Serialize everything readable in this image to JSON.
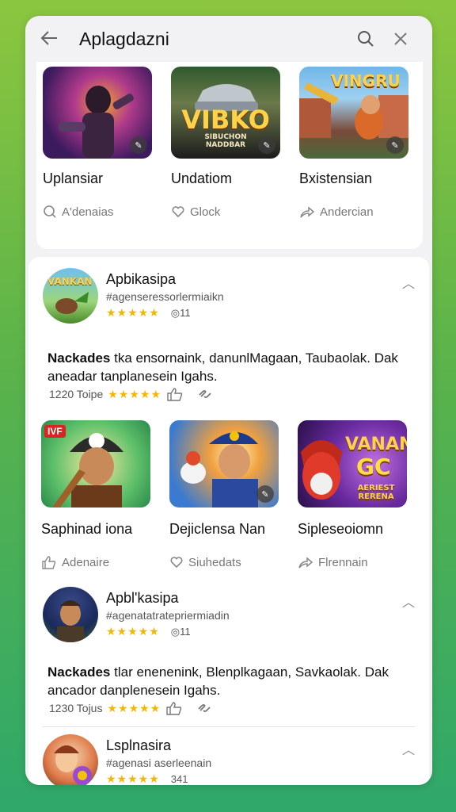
{
  "header": {
    "title": "Aplagdazni"
  },
  "top_tiles": [
    {
      "name": "Uplansiar",
      "action": "A'denaias",
      "action_icon": "search-icon"
    },
    {
      "name": "Undatiom",
      "action": "Glock",
      "action_icon": "heart-icon",
      "art_text": "VIBKO",
      "art_sub": "SIBUCHON\nNADDBAR"
    },
    {
      "name": "Bxistensian",
      "action": "Andercian",
      "action_icon": "share-icon",
      "art_text": "VINGRU"
    }
  ],
  "apps": [
    {
      "name": "Apbikasipa",
      "subtitle": "#agenseressorlermiaikn",
      "rating_count": "11",
      "description_bold": "Nackades",
      "description": " tka ensornaink, danunlMagaan, Taubaolak. Dak aneadar tanplanesein Igahs.",
      "meta_label": "1220 Toipe",
      "icon_text": "VANKAN"
    },
    {
      "name": "Apbl'kasipa",
      "subtitle": "#agenatatratepriermiadin",
      "rating_count": "11",
      "description_bold": "Nackades",
      "description": " tlar enenenink, Blenplkagaan, Savkaolak. Dak ancador danplenesein Igahs.",
      "meta_label": "1230 Tojus"
    },
    {
      "name": "Lsplnasira",
      "subtitle": "#agenasi aserleenain",
      "rating_count": "341"
    }
  ],
  "mid_tiles": [
    {
      "name": "Saphinad iona",
      "action": "Adenaire",
      "action_icon": "thumbs-up-icon",
      "art_text": "IVF"
    },
    {
      "name": "Dejiclensa Nan",
      "action": "Siuhedats",
      "action_icon": "heart-icon"
    },
    {
      "name": "Sipleseoiomn",
      "action": "Flrennain",
      "action_icon": "share-icon",
      "art_text": "VANAN",
      "art_sub": "GC",
      "art_sub2": "AERIEST RERENA"
    }
  ]
}
